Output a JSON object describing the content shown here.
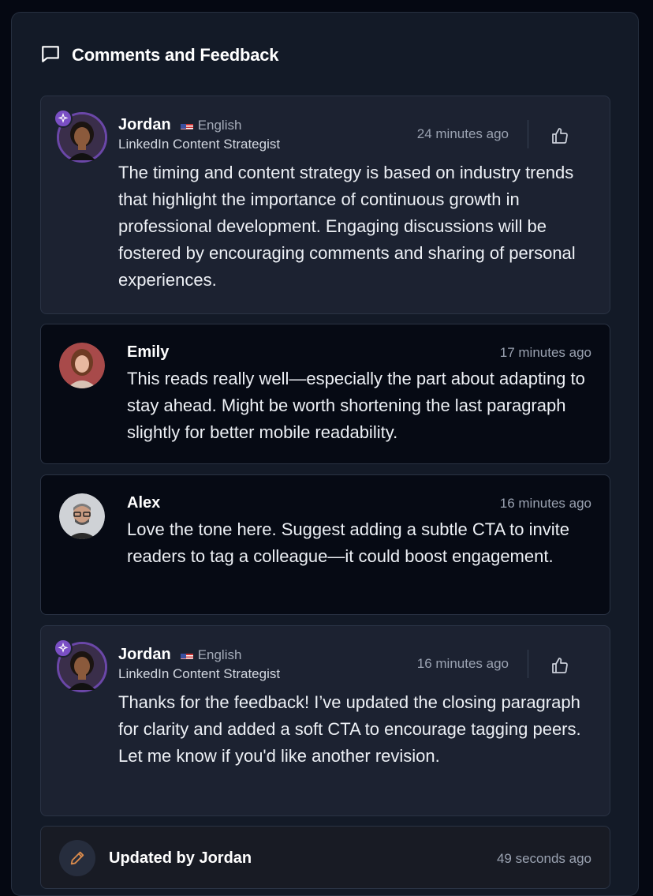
{
  "panel": {
    "title": "Comments and Feedback",
    "icon": "message-square-icon"
  },
  "comments": [
    {
      "type": "ai",
      "name": "Jordan",
      "language": "English",
      "role": "LinkedIn Content Strategist",
      "time": "24 minutes ago",
      "text": "The timing and content strategy is based on industry trends that highlight the importance of continuous growth in professional development. Engaging discussions will be fostered by encouraging comments and sharing of personal experiences."
    },
    {
      "type": "user",
      "name": "Emily",
      "time": "17 minutes ago",
      "text": "This reads really well—especially the part about adapting to stay ahead. Might be worth shortening the last paragraph slightly for better mobile readability."
    },
    {
      "type": "user",
      "name": "Alex",
      "time": "16 minutes ago",
      "text": "Love the tone here. Suggest adding a subtle CTA to invite readers to tag a colleague—it could boost engagement."
    },
    {
      "type": "ai",
      "name": "Jordan",
      "language": "English",
      "role": "LinkedIn Content Strategist",
      "time": "16 minutes ago",
      "text": "Thanks for the feedback! I’ve updated the closing paragraph for clarity and added a soft CTA to encourage tagging peers. Let me know if you'd like another revision."
    }
  ],
  "update": {
    "label": "Updated by Jordan",
    "time": "49 seconds ago",
    "icon": "pencil-icon"
  },
  "colors": {
    "accent": "#7a4fc4",
    "panel": "#131a27",
    "ai_card": "#1c2231",
    "user_card": "#060a14"
  }
}
